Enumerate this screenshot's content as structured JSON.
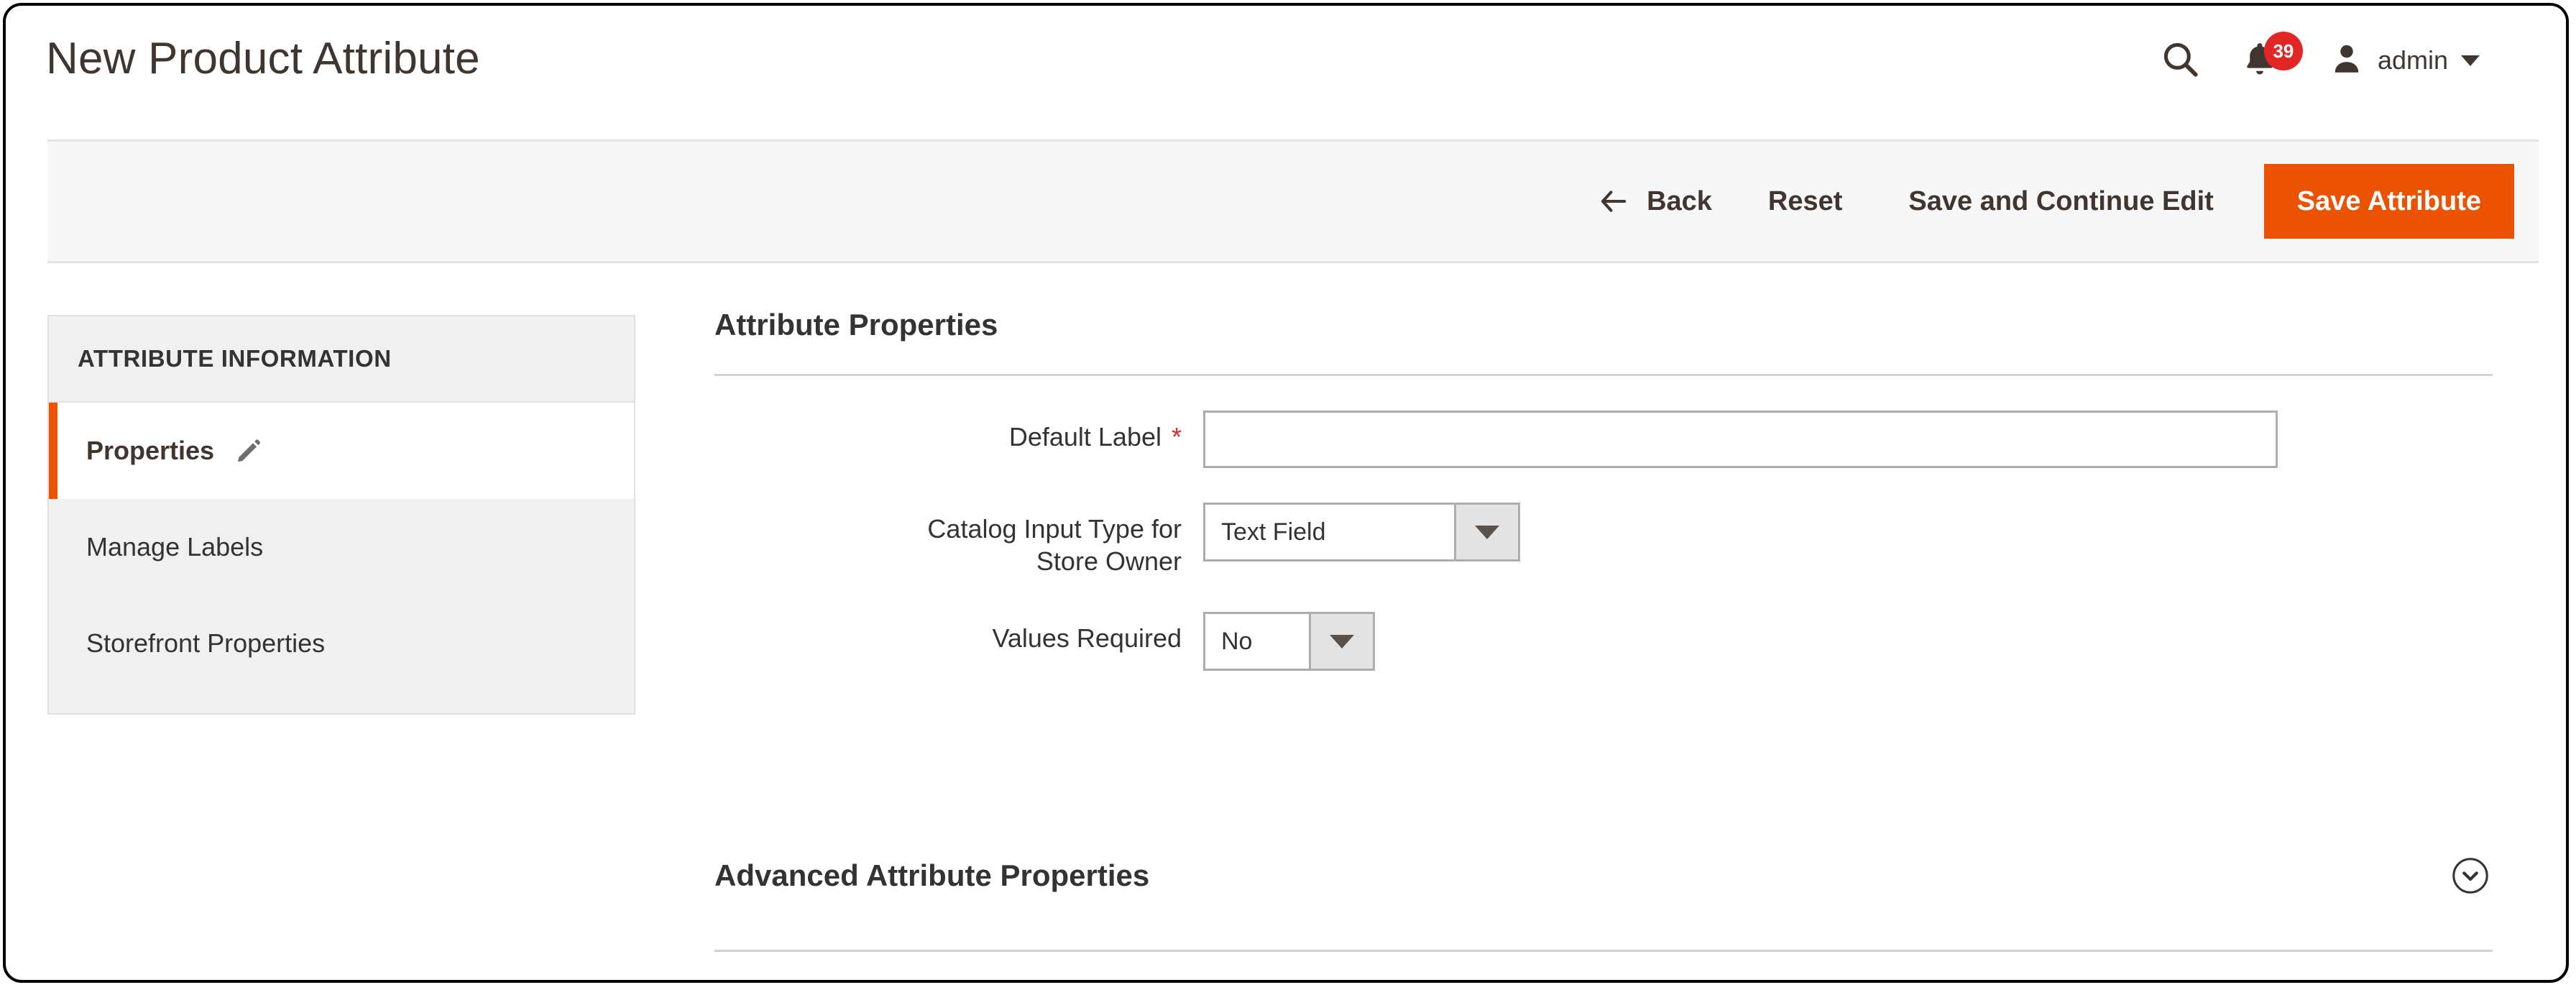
{
  "header": {
    "title": "New Product Attribute",
    "search_icon": "search-icon",
    "notifications_icon": "bell-icon",
    "notifications_count": "39",
    "user_icon": "user-avatar-icon",
    "user_name": "admin",
    "caret_icon": "caret-down-icon"
  },
  "actions": {
    "back_icon": "arrow-left-icon",
    "back": "Back",
    "reset": "Reset",
    "save_and_continue": "Save and Continue Edit",
    "save_attribute": "Save Attribute",
    "primary_color": "#eb5202"
  },
  "sidebar": {
    "title": "ATTRIBUTE INFORMATION",
    "active_accent_color": "#eb5202",
    "items": [
      {
        "label": "Properties",
        "icon": "pencil-icon",
        "active": true
      },
      {
        "label": "Manage Labels",
        "active": false
      },
      {
        "label": "Storefront Properties",
        "active": false
      }
    ]
  },
  "main": {
    "section_title": "Attribute Properties",
    "fields": {
      "default_label": {
        "label": "Default Label",
        "required_marker": "*",
        "value": "",
        "placeholder": ""
      },
      "catalog_input_type": {
        "label_line1": "Catalog Input Type for",
        "label_line2": "Store Owner",
        "selected": "Text Field"
      },
      "values_required": {
        "label": "Values Required",
        "selected": "No"
      }
    }
  },
  "advanced": {
    "title": "Advanced Attribute Properties",
    "toggle_icon": "chevron-down-circle-icon"
  }
}
